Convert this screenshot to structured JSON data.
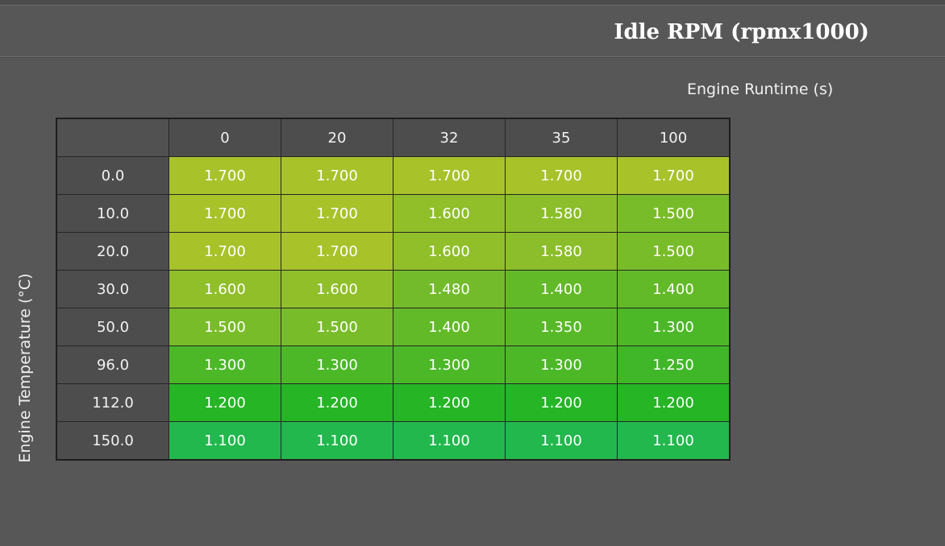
{
  "title": "Idle RPM (rpmx1000)",
  "x_axis_label": "Engine Runtime (s)",
  "y_axis_label": "Engine Temperature (°C)",
  "columns": [
    "0",
    "20",
    "32",
    "35",
    "100"
  ],
  "rows": [
    {
      "label": "0.0",
      "cells": [
        {
          "value": "1.700",
          "color": "#a8c22a"
        },
        {
          "value": "1.700",
          "color": "#a8c22a"
        },
        {
          "value": "1.700",
          "color": "#a8c22a"
        },
        {
          "value": "1.700",
          "color": "#a8c22a"
        },
        {
          "value": "1.700",
          "color": "#a8c22a"
        }
      ]
    },
    {
      "label": "10.0",
      "cells": [
        {
          "value": "1.700",
          "color": "#a8c22a"
        },
        {
          "value": "1.700",
          "color": "#a8c22a"
        },
        {
          "value": "1.600",
          "color": "#90bf2a"
        },
        {
          "value": "1.580",
          "color": "#8bbe2a"
        },
        {
          "value": "1.500",
          "color": "#79bc2a"
        }
      ]
    },
    {
      "label": "20.0",
      "cells": [
        {
          "value": "1.700",
          "color": "#a8c22a"
        },
        {
          "value": "1.700",
          "color": "#a8c22a"
        },
        {
          "value": "1.600",
          "color": "#90bf2a"
        },
        {
          "value": "1.580",
          "color": "#8bbe2a"
        },
        {
          "value": "1.500",
          "color": "#79bc2a"
        }
      ]
    },
    {
      "label": "30.0",
      "cells": [
        {
          "value": "1.600",
          "color": "#90bf2a"
        },
        {
          "value": "1.600",
          "color": "#90bf2a"
        },
        {
          "value": "1.480",
          "color": "#73bb2a"
        },
        {
          "value": "1.400",
          "color": "#62ba28"
        },
        {
          "value": "1.400",
          "color": "#62ba28"
        }
      ]
    },
    {
      "label": "50.0",
      "cells": [
        {
          "value": "1.500",
          "color": "#79bc2a"
        },
        {
          "value": "1.500",
          "color": "#79bc2a"
        },
        {
          "value": "1.400",
          "color": "#62ba28"
        },
        {
          "value": "1.350",
          "color": "#58b928"
        },
        {
          "value": "1.300",
          "color": "#4cb828"
        }
      ]
    },
    {
      "label": "96.0",
      "cells": [
        {
          "value": "1.300",
          "color": "#4cb828"
        },
        {
          "value": "1.300",
          "color": "#4cb828"
        },
        {
          "value": "1.300",
          "color": "#4cb828"
        },
        {
          "value": "1.300",
          "color": "#4cb828"
        },
        {
          "value": "1.250",
          "color": "#40b728"
        }
      ]
    },
    {
      "label": "112.0",
      "cells": [
        {
          "value": "1.200",
          "color": "#25b525"
        },
        {
          "value": "1.200",
          "color": "#25b525"
        },
        {
          "value": "1.200",
          "color": "#25b525"
        },
        {
          "value": "1.200",
          "color": "#25b525"
        },
        {
          "value": "1.200",
          "color": "#25b525"
        }
      ]
    },
    {
      "label": "150.0",
      "cells": [
        {
          "value": "1.100",
          "color": "#22b84e"
        },
        {
          "value": "1.100",
          "color": "#22b84e"
        },
        {
          "value": "1.100",
          "color": "#22b84e"
        },
        {
          "value": "1.100",
          "color": "#22b84e"
        },
        {
          "value": "1.100",
          "color": "#22b84e"
        }
      ]
    }
  ]
}
